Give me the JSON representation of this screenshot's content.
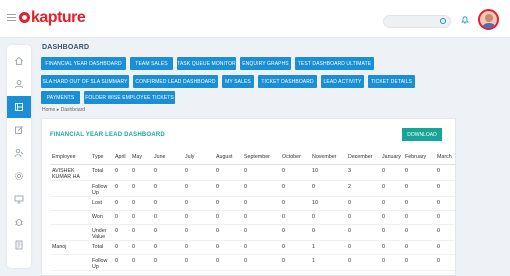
{
  "header": {
    "logo_text": "kapture",
    "search_placeholder": ""
  },
  "page_title": "Dashboard",
  "dashboard_buttons": [
    "Financial Year Dashboard",
    "Team Sales",
    "Task Queue Monitor",
    "Enquiry Graphs",
    "Test Dashboard Ultimate",
    "SLA Hard Out of SLA Summary",
    "Confirmed Lead Dashboard",
    "My Sales",
    "Ticket Dashboard",
    "Lead Activity",
    "Ticket Details",
    "Payments",
    "Folder Wise Employee Tickets"
  ],
  "breadcrumb": "Home  ▸  Dashboard",
  "card": {
    "title": "Financial Year Lead Dashboard",
    "download_label": "Download"
  },
  "table": {
    "headers": [
      "Employee",
      "Type",
      "April",
      "May",
      "June",
      "July",
      "August",
      "September",
      "October",
      "November",
      "December",
      "January",
      "February",
      "March"
    ],
    "rows": [
      {
        "employee": "AVISHEK KUMAR HA",
        "type": "Total",
        "values": [
          "0",
          "0",
          "0",
          "0",
          "0",
          "0",
          "0",
          "10",
          "3",
          "0",
          "0",
          "0"
        ]
      },
      {
        "employee": "",
        "type": "Follow Up",
        "values": [
          "0",
          "0",
          "0",
          "0",
          "0",
          "0",
          "0",
          "0",
          "2",
          "0",
          "0",
          "0"
        ]
      },
      {
        "employee": "",
        "type": "Lost",
        "values": [
          "0",
          "0",
          "0",
          "0",
          "0",
          "0",
          "0",
          "10",
          "0",
          "0",
          "0",
          "0"
        ]
      },
      {
        "employee": "",
        "type": "Won",
        "values": [
          "0",
          "0",
          "0",
          "0",
          "0",
          "0",
          "0",
          "0",
          "0",
          "0",
          "0",
          "0"
        ]
      },
      {
        "employee": "",
        "type": "Under Value",
        "values": [
          "0",
          "0",
          "0",
          "0",
          "0",
          "0",
          "0",
          "0",
          "0",
          "0",
          "0",
          "0"
        ]
      },
      {
        "employee": "Manoj",
        "type": "Total",
        "values": [
          "0",
          "0",
          "0",
          "0",
          "0",
          "0",
          "0",
          "1",
          "0",
          "0",
          "0",
          "0"
        ]
      },
      {
        "employee": "",
        "type": "Follow Up",
        "values": [
          "0",
          "0",
          "0",
          "0",
          "0",
          "0",
          "0",
          "1",
          "0",
          "0",
          "0",
          "0"
        ]
      }
    ]
  },
  "colors": {
    "primary": "#1a8fd6",
    "accent_teal": "#16a596",
    "brand_red": "#e4202b"
  },
  "sidebar_icons": [
    "home-icon",
    "user-icon",
    "dashboard-icon",
    "edit-icon",
    "person-icon",
    "settings-icon",
    "monitor-icon",
    "bug-icon",
    "report-icon"
  ]
}
